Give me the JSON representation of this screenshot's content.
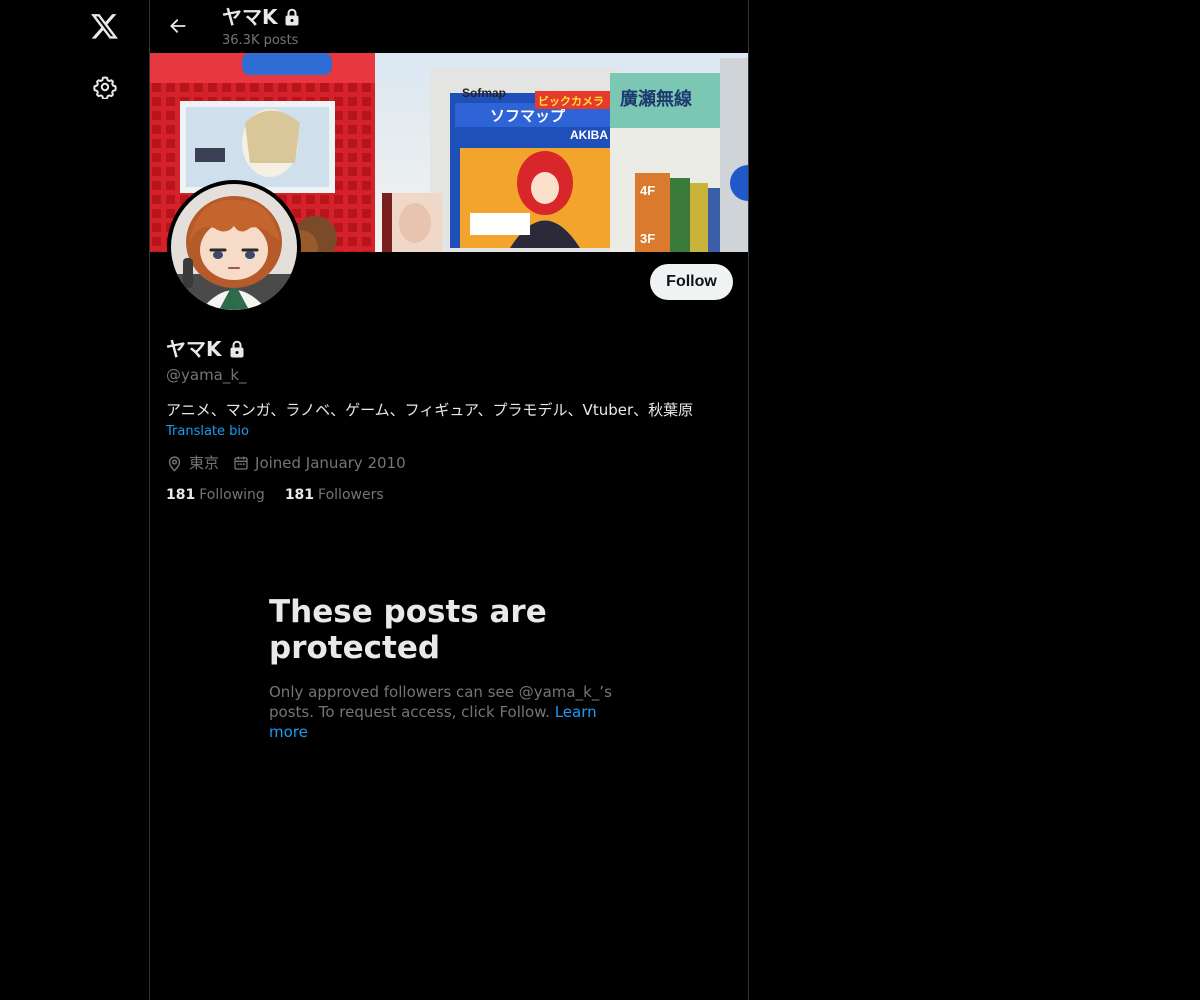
{
  "header": {
    "name": "ヤマK",
    "posts": "36.3K posts"
  },
  "banner": {
    "signs": {
      "sofmap": "Sofmap",
      "sofmap_katakana": "ソフマップ",
      "akiba": "AKIBA",
      "bic": "ビックカメラ",
      "right": "廣瀬無線",
      "floor_4f": "4F",
      "floor_3f": "3F"
    }
  },
  "profile": {
    "name": "ヤマK",
    "handle": "@yama_k_",
    "bio": "アニメ、マンガ、ラノベ、ゲーム、フィギュア、プラモデル、Vtuber、秋葉原",
    "translate_label": "Translate bio",
    "location": "東京",
    "joined": "Joined January 2010",
    "following_count": "181",
    "following_label": "Following",
    "followers_count": "181",
    "followers_label": "Followers",
    "follow_label": "Follow"
  },
  "protected": {
    "title": "These posts are protected",
    "text": "Only approved followers can see @yama_k_’s posts. To request access, click Follow.",
    "learn_more": "Learn more"
  },
  "icons": {
    "logo": "x-logo-icon",
    "settings": "gear-icon",
    "back": "arrow-left-icon",
    "lock": "lock-icon",
    "location": "location-pin-icon",
    "calendar": "calendar-icon"
  },
  "colors": {
    "background": "#000000",
    "text": "#e7e9ea",
    "muted": "#71767b",
    "accent": "#1d9bf0",
    "border": "#2f3336",
    "follow_bg": "#eff3f4"
  }
}
